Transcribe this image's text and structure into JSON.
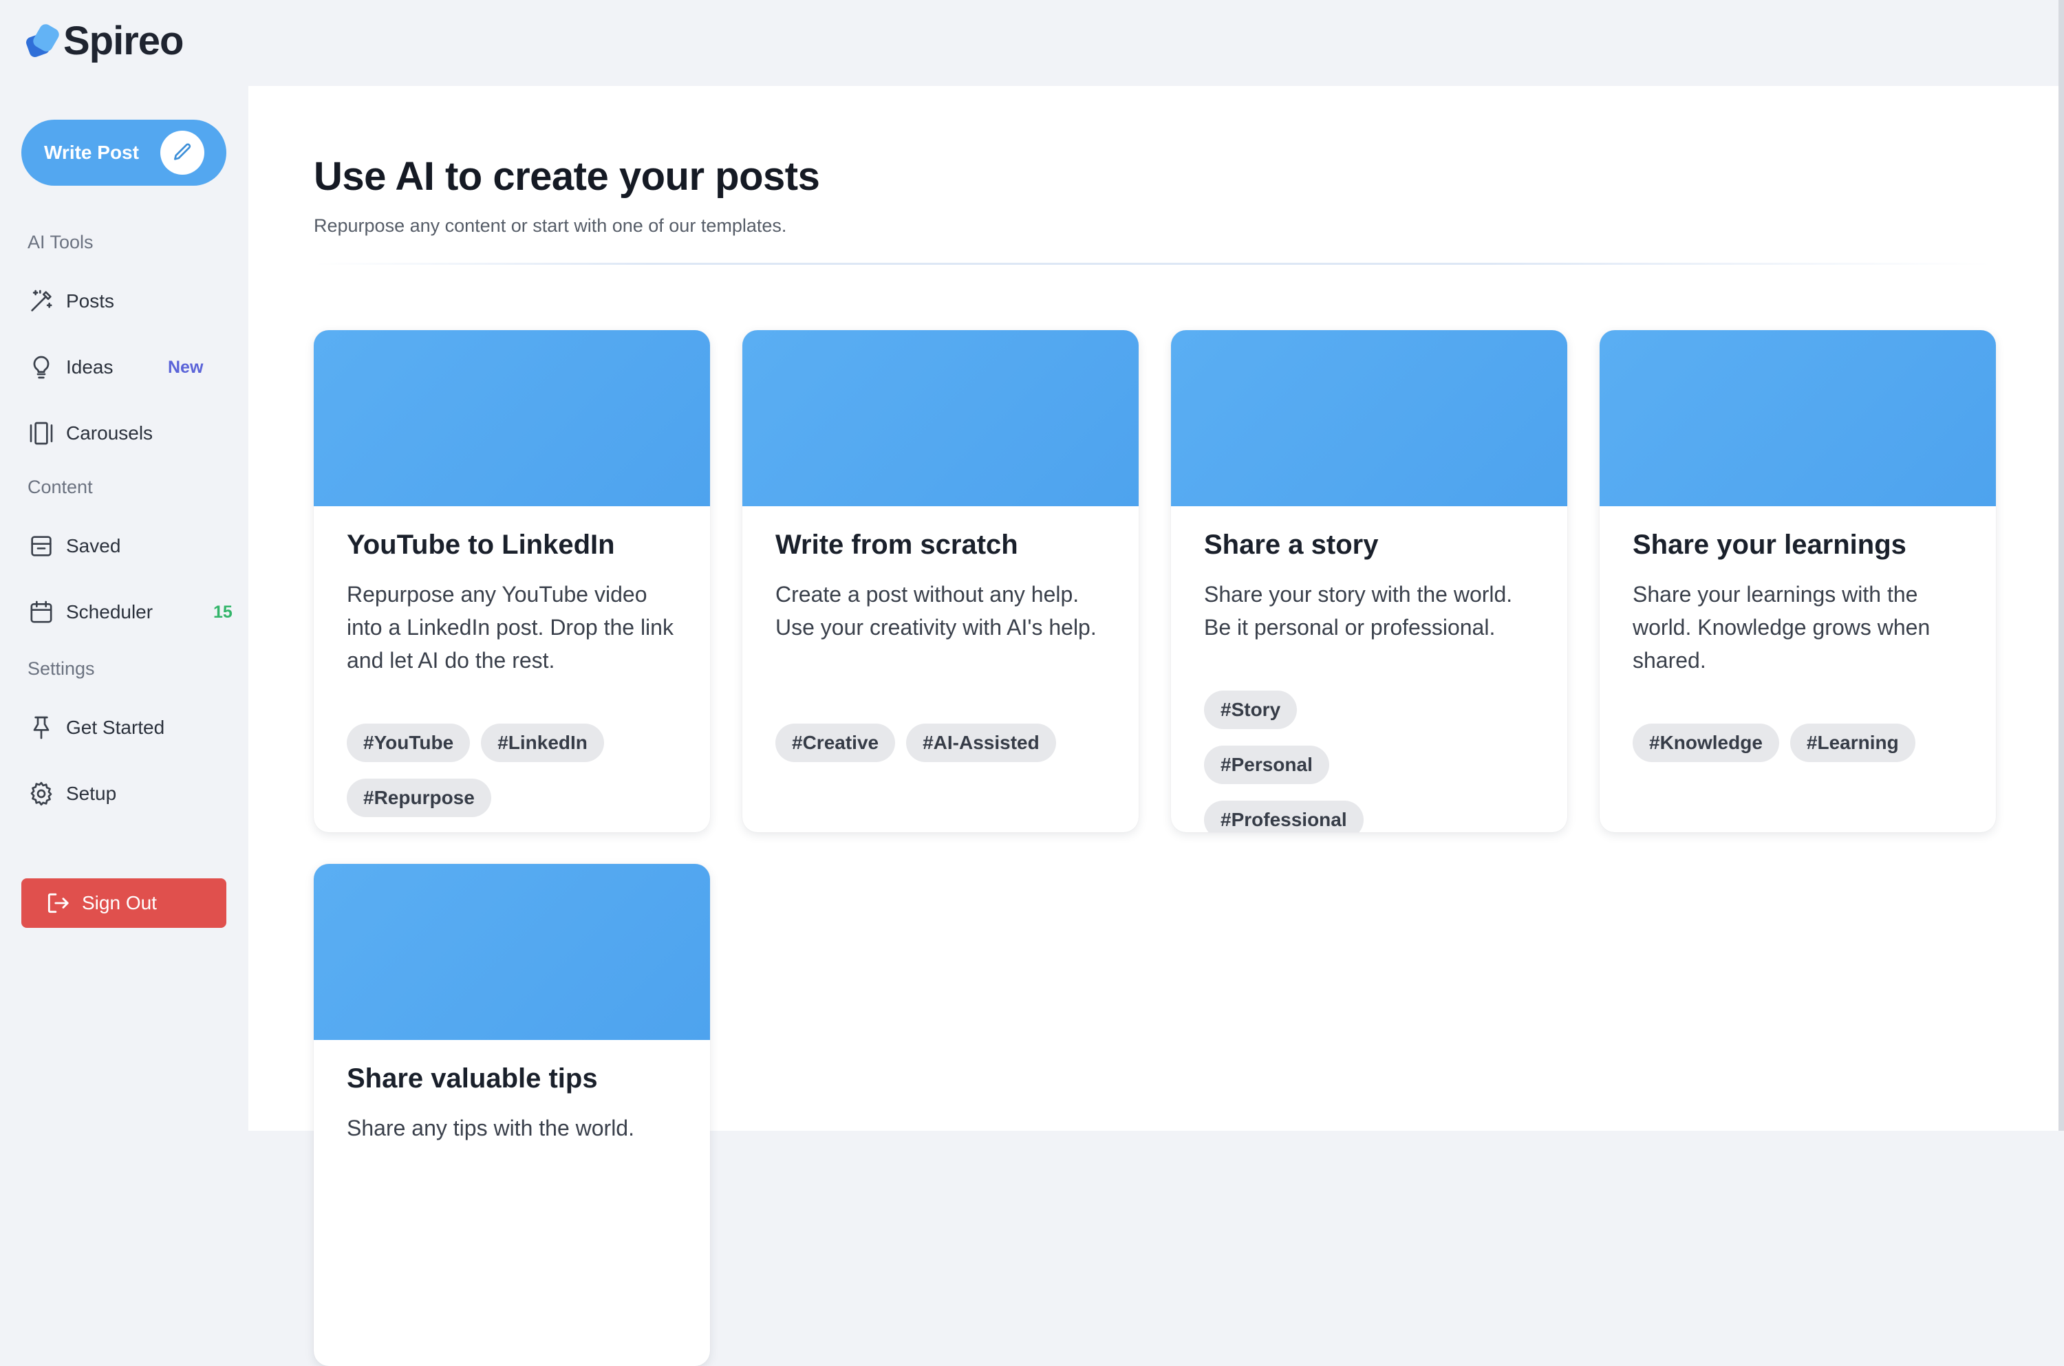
{
  "app": {
    "name": "Spireo"
  },
  "sidebar": {
    "write_post_label": "Write Post",
    "sections": {
      "ai_tools": "AI Tools",
      "content": "Content",
      "settings": "Settings"
    },
    "items": {
      "posts": "Posts",
      "ideas": "Ideas",
      "ideas_badge": "New",
      "carousels": "Carousels",
      "saved": "Saved",
      "scheduler": "Scheduler",
      "scheduler_count": "15",
      "get_started": "Get Started",
      "setup": "Setup"
    },
    "sign_out_label": "Sign Out"
  },
  "main": {
    "title": "Use AI to create your posts",
    "subtitle": "Repurpose any content or start with one of our templates."
  },
  "cards": [
    {
      "title": "YouTube to LinkedIn",
      "description": "Repurpose any YouTube video into a LinkedIn post. Drop the link and let AI do the rest.",
      "tags": [
        "#YouTube",
        "#LinkedIn",
        "#Repurpose"
      ]
    },
    {
      "title": "Write from scratch",
      "description": "Create a post without any help. Use your creativity with AI's help.",
      "tags": [
        "#Creative",
        "#AI-Assisted"
      ]
    },
    {
      "title": "Share a story",
      "description": "Share your story with the world. Be it personal or professional.",
      "tags": [
        "#Story",
        "#Personal",
        "#Professional"
      ]
    },
    {
      "title": "Share your learnings",
      "description": "Share your learnings with the world. Knowledge grows when shared.",
      "tags": [
        "#Knowledge",
        "#Learning"
      ]
    },
    {
      "title": "Share valuable tips",
      "description": "Share any tips with the world."
    }
  ],
  "colors": {
    "accent": "#53a7f0",
    "banner": "#4ea3ee",
    "danger": "#e0504d",
    "badge_new": "#5a63d8",
    "badge_count": "#33b56a"
  }
}
